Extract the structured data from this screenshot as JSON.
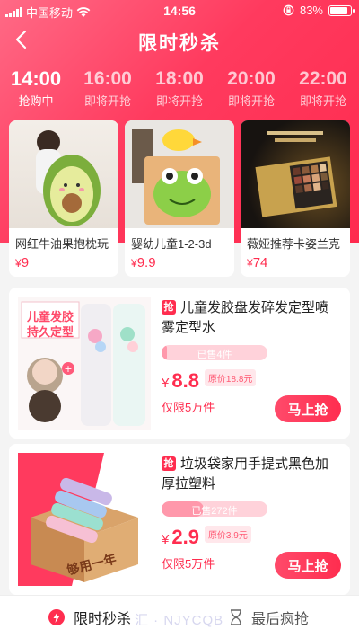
{
  "status": {
    "carrier": "中国移动",
    "time": "14:56",
    "battery": "83%"
  },
  "nav": {
    "title": "限时秒杀"
  },
  "time_slots": [
    {
      "time": "14:00",
      "status": "抢购中"
    },
    {
      "time": "16:00",
      "status": "即将开抢"
    },
    {
      "time": "18:00",
      "status": "即将开抢"
    },
    {
      "time": "20:00",
      "status": "即将开抢"
    },
    {
      "time": "22:00",
      "status": "即将开抢"
    }
  ],
  "featured": [
    {
      "name": "网红牛油果抱枕玩",
      "currency": "¥",
      "price": "9"
    },
    {
      "name": "婴幼儿童1-2-3d",
      "currency": "¥",
      "price": "9.9"
    },
    {
      "name": "薇娅推荐卡姿兰克",
      "currency": "¥",
      "price": "74"
    }
  ],
  "products": [
    {
      "badge": "抢",
      "title": "儿童发胶盘发碎发定型喷雾定型水",
      "sold_text": "已售4件",
      "sold_fraction": 0.05,
      "currency": "¥",
      "price": "8.8",
      "original": "原价18.8元",
      "limit": "仅限5万件",
      "button": "马上抢",
      "img_text_1": "儿童发胶",
      "img_text_2": "持久定型"
    },
    {
      "badge": "抢",
      "title": "垃圾袋家用手提式黑色加厚拉塑料",
      "sold_text": "已售272件",
      "sold_fraction": 0.4,
      "currency": "¥",
      "price": "2.9",
      "original": "原价3.9元",
      "limit": "仅限5万件",
      "button": "马上抢",
      "img_text_1": "够用一年"
    }
  ],
  "bottom_tabs": [
    {
      "label": "限时秒杀",
      "icon": "flash-icon"
    },
    {
      "label": "最后疯抢",
      "icon": "hourglass-icon"
    }
  ],
  "watermark": "汇 · NJYCQB",
  "colors": {
    "brand": "#ff2d4f",
    "header_gradient_start": "#ff6a86"
  }
}
